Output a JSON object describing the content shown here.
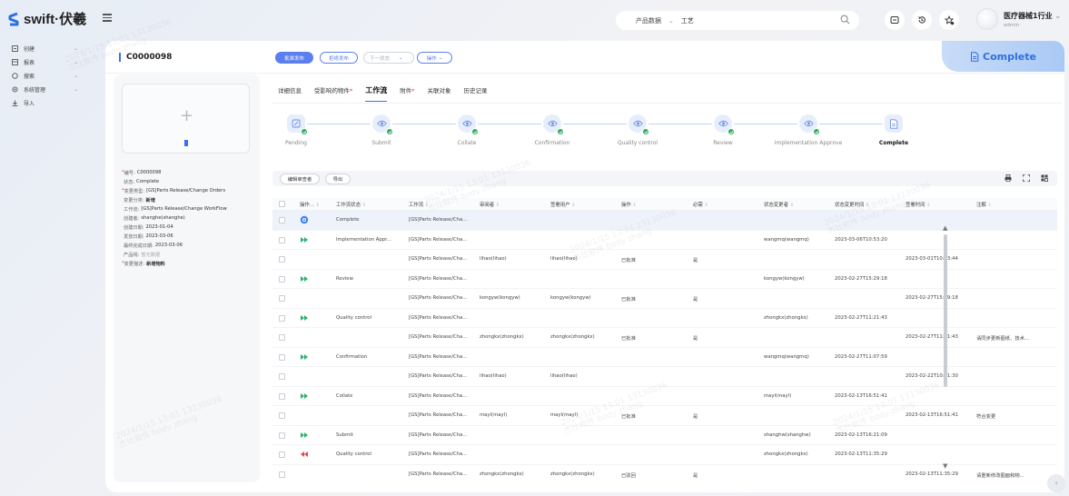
{
  "brand": {
    "name": "swift·伏羲",
    "accent": "#3b6ff0"
  },
  "search": {
    "type": "产品数据",
    "value": "工艺"
  },
  "user": {
    "name": "医疗器械1行业",
    "sub": "admin"
  },
  "nav": [
    {
      "label": "创建",
      "icon": "create-icon",
      "has_chevron": true
    },
    {
      "label": "报表",
      "icon": "report-icon",
      "has_chevron": true
    },
    {
      "label": "搜索",
      "icon": "search-icon",
      "has_chevron": true
    },
    {
      "label": "系统管理",
      "icon": "settings-icon",
      "has_chevron": true
    },
    {
      "label": "导入",
      "icon": "import-icon",
      "has_chevron": false
    }
  ],
  "header": {
    "doc_id": "C0000098",
    "actions": {
      "publish": "批准发布",
      "reject": "拒绝发布",
      "next_state": "下一状态",
      "operate": "操作"
    },
    "status": "Complete"
  },
  "props": [
    {
      "key": "编号:",
      "value": "C0000098",
      "required": true
    },
    {
      "key": "状态:",
      "value": "Complete",
      "required": false
    },
    {
      "key": "变更类型:",
      "value": "[GS]Parts Release/Change Orders",
      "required": true
    },
    {
      "key": "变更分类:",
      "value": "新增",
      "required": false,
      "bold": true
    },
    {
      "key": "工作流:",
      "value": "[GS]Parts Release/Change WorkFlow",
      "required": false
    },
    {
      "key": "创建者:",
      "value": "shanghe(shanghe)",
      "required": false
    },
    {
      "key": "创建日期:",
      "value": "2023-01-04",
      "required": false
    },
    {
      "key": "发放日期:",
      "value": "2023-03-06",
      "required": false
    },
    {
      "key": "最终完成日期:",
      "value": "2023-03-06",
      "required": false
    },
    {
      "key": "产品线:",
      "value": "暂无数据",
      "required": false,
      "muted": true
    },
    {
      "key": "变更描述:",
      "value": "新增物料",
      "required": true,
      "bold": true
    }
  ],
  "tabs": [
    {
      "label": "详细信息",
      "star": ""
    },
    {
      "label": "受影响的物件",
      "star": "*"
    },
    {
      "label": "工作流",
      "star": "",
      "active": true
    },
    {
      "label": "附件",
      "star": "*"
    },
    {
      "label": "关联对象",
      "star": ""
    },
    {
      "label": "历史记录",
      "star": ""
    }
  ],
  "workflow_steps": [
    {
      "label": "Pending",
      "icon": "edit-icon"
    },
    {
      "label": "Submit",
      "icon": "eye-icon"
    },
    {
      "label": "Collate",
      "icon": "eye-icon"
    },
    {
      "label": "Confirmation",
      "icon": "eye-icon"
    },
    {
      "label": "Quality control",
      "icon": "eye-icon"
    },
    {
      "label": "Review",
      "icon": "eye-icon"
    },
    {
      "label": "Implementation Approve",
      "icon": "eye-icon"
    },
    {
      "label": "Complete",
      "icon": "document-icon",
      "current": true
    }
  ],
  "toolbar": {
    "edit_reviewer": "编辑审查者",
    "export": "导出"
  },
  "table": {
    "columns": [
      "操作...",
      "工作流状态",
      "工作流",
      "审阅者",
      "签署用户",
      "操作",
      "必需",
      "状态变更者",
      "状态变更时间",
      "签署时间",
      "注解"
    ],
    "rows": [
      {
        "op": "target",
        "state": "Complete",
        "wf": "[GS]Parts Release/Cha...",
        "reviewer": "",
        "signer": "",
        "action": "",
        "req": "",
        "changer": "",
        "ctime": "",
        "stime": "",
        "note": "",
        "hl": true
      },
      {
        "op": "fwd",
        "state": "Implementation Appr...",
        "wf": "[GS]Parts Release/Cha...",
        "reviewer": "",
        "signer": "",
        "action": "",
        "req": "",
        "changer": "wangmq(wangmq)",
        "ctime": "2023-03-06T10:53:20",
        "stime": "",
        "note": ""
      },
      {
        "op": "",
        "state": "",
        "wf": "[GS]Parts Release/Cha...",
        "reviewer": "lihao(lihao)",
        "signer": "lihao(lihao)",
        "action": "已批准",
        "req": "是",
        "changer": "",
        "ctime": "",
        "stime": "2023-03-01T10:43:44",
        "note": ""
      },
      {
        "op": "fwd",
        "state": "Review",
        "wf": "[GS]Parts Release/Cha...",
        "reviewer": "",
        "signer": "",
        "action": "",
        "req": "",
        "changer": "kongyw(kongyw)",
        "ctime": "2023-02-27T15:29:18",
        "stime": "",
        "note": ""
      },
      {
        "op": "",
        "state": "",
        "wf": "[GS]Parts Release/Cha...",
        "reviewer": "kongyw(kongyw)",
        "signer": "kongyw(kongyw)",
        "action": "已批准",
        "req": "是",
        "changer": "",
        "ctime": "",
        "stime": "2023-02-27T15:29:18",
        "note": ""
      },
      {
        "op": "fwd",
        "state": "Quality control",
        "wf": "[GS]Parts Release/Cha...",
        "reviewer": "",
        "signer": "",
        "action": "",
        "req": "",
        "changer": "zhongkx(zhongkx)",
        "ctime": "2023-02-27T11:21:43",
        "stime": "",
        "note": ""
      },
      {
        "op": "",
        "state": "",
        "wf": "[GS]Parts Release/Cha...",
        "reviewer": "zhongkx(zhongkx)",
        "signer": "zhongkx(zhongkx)",
        "action": "已批准",
        "req": "是",
        "changer": "",
        "ctime": "",
        "stime": "2023-02-27T11:21:43",
        "note": "请同步更新图纸、技术..."
      },
      {
        "op": "fwd",
        "state": "Confirmation",
        "wf": "[GS]Parts Release/Cha...",
        "reviewer": "",
        "signer": "",
        "action": "",
        "req": "",
        "changer": "wangmq(wangmq)",
        "ctime": "2023-02-27T11:07:59",
        "stime": "",
        "note": ""
      },
      {
        "op": "",
        "state": "",
        "wf": "[GS]Parts Release/Cha...",
        "reviewer": "lihao(lihao)",
        "signer": "lihao(lihao)",
        "action": "",
        "req": "",
        "changer": "",
        "ctime": "",
        "stime": "2023-02-22T10:51:30",
        "note": ""
      },
      {
        "op": "fwd",
        "state": "Collate",
        "wf": "[GS]Parts Release/Cha...",
        "reviewer": "",
        "signer": "",
        "action": "",
        "req": "",
        "changer": "mayl(mayl)",
        "ctime": "2023-02-13T16:51:41",
        "stime": "",
        "note": ""
      },
      {
        "op": "",
        "state": "",
        "wf": "[GS]Parts Release/Cha...",
        "reviewer": "mayl(mayl)",
        "signer": "mayl(mayl)",
        "action": "已批准",
        "req": "是",
        "changer": "",
        "ctime": "",
        "stime": "2023-02-13T16:51:41",
        "note": "符合变更"
      },
      {
        "op": "fwd",
        "state": "Submit",
        "wf": "[GS]Parts Release/Cha...",
        "reviewer": "",
        "signer": "",
        "action": "",
        "req": "",
        "changer": "shanghw(shanghw)",
        "ctime": "2023-02-13T16:21:09",
        "stime": "",
        "note": ""
      },
      {
        "op": "back",
        "state": "Quality control",
        "wf": "[GS]Parts Release/Cha...",
        "reviewer": "",
        "signer": "",
        "action": "",
        "req": "",
        "changer": "zhongkx(zhongkx)",
        "ctime": "2023-02-13T11:35:29",
        "stime": "",
        "note": ""
      },
      {
        "op": "",
        "state": "",
        "wf": "[GS]Parts Release/Cha...",
        "reviewer": "zhongkx(zhongkx)",
        "signer": "zhongkx(zhongkx)",
        "action": "已驳回",
        "req": "是",
        "changer": "",
        "ctime": "",
        "stime": "2023-02-13T11:35:29",
        "note": "请重新修改图面和物..."
      }
    ]
  }
}
